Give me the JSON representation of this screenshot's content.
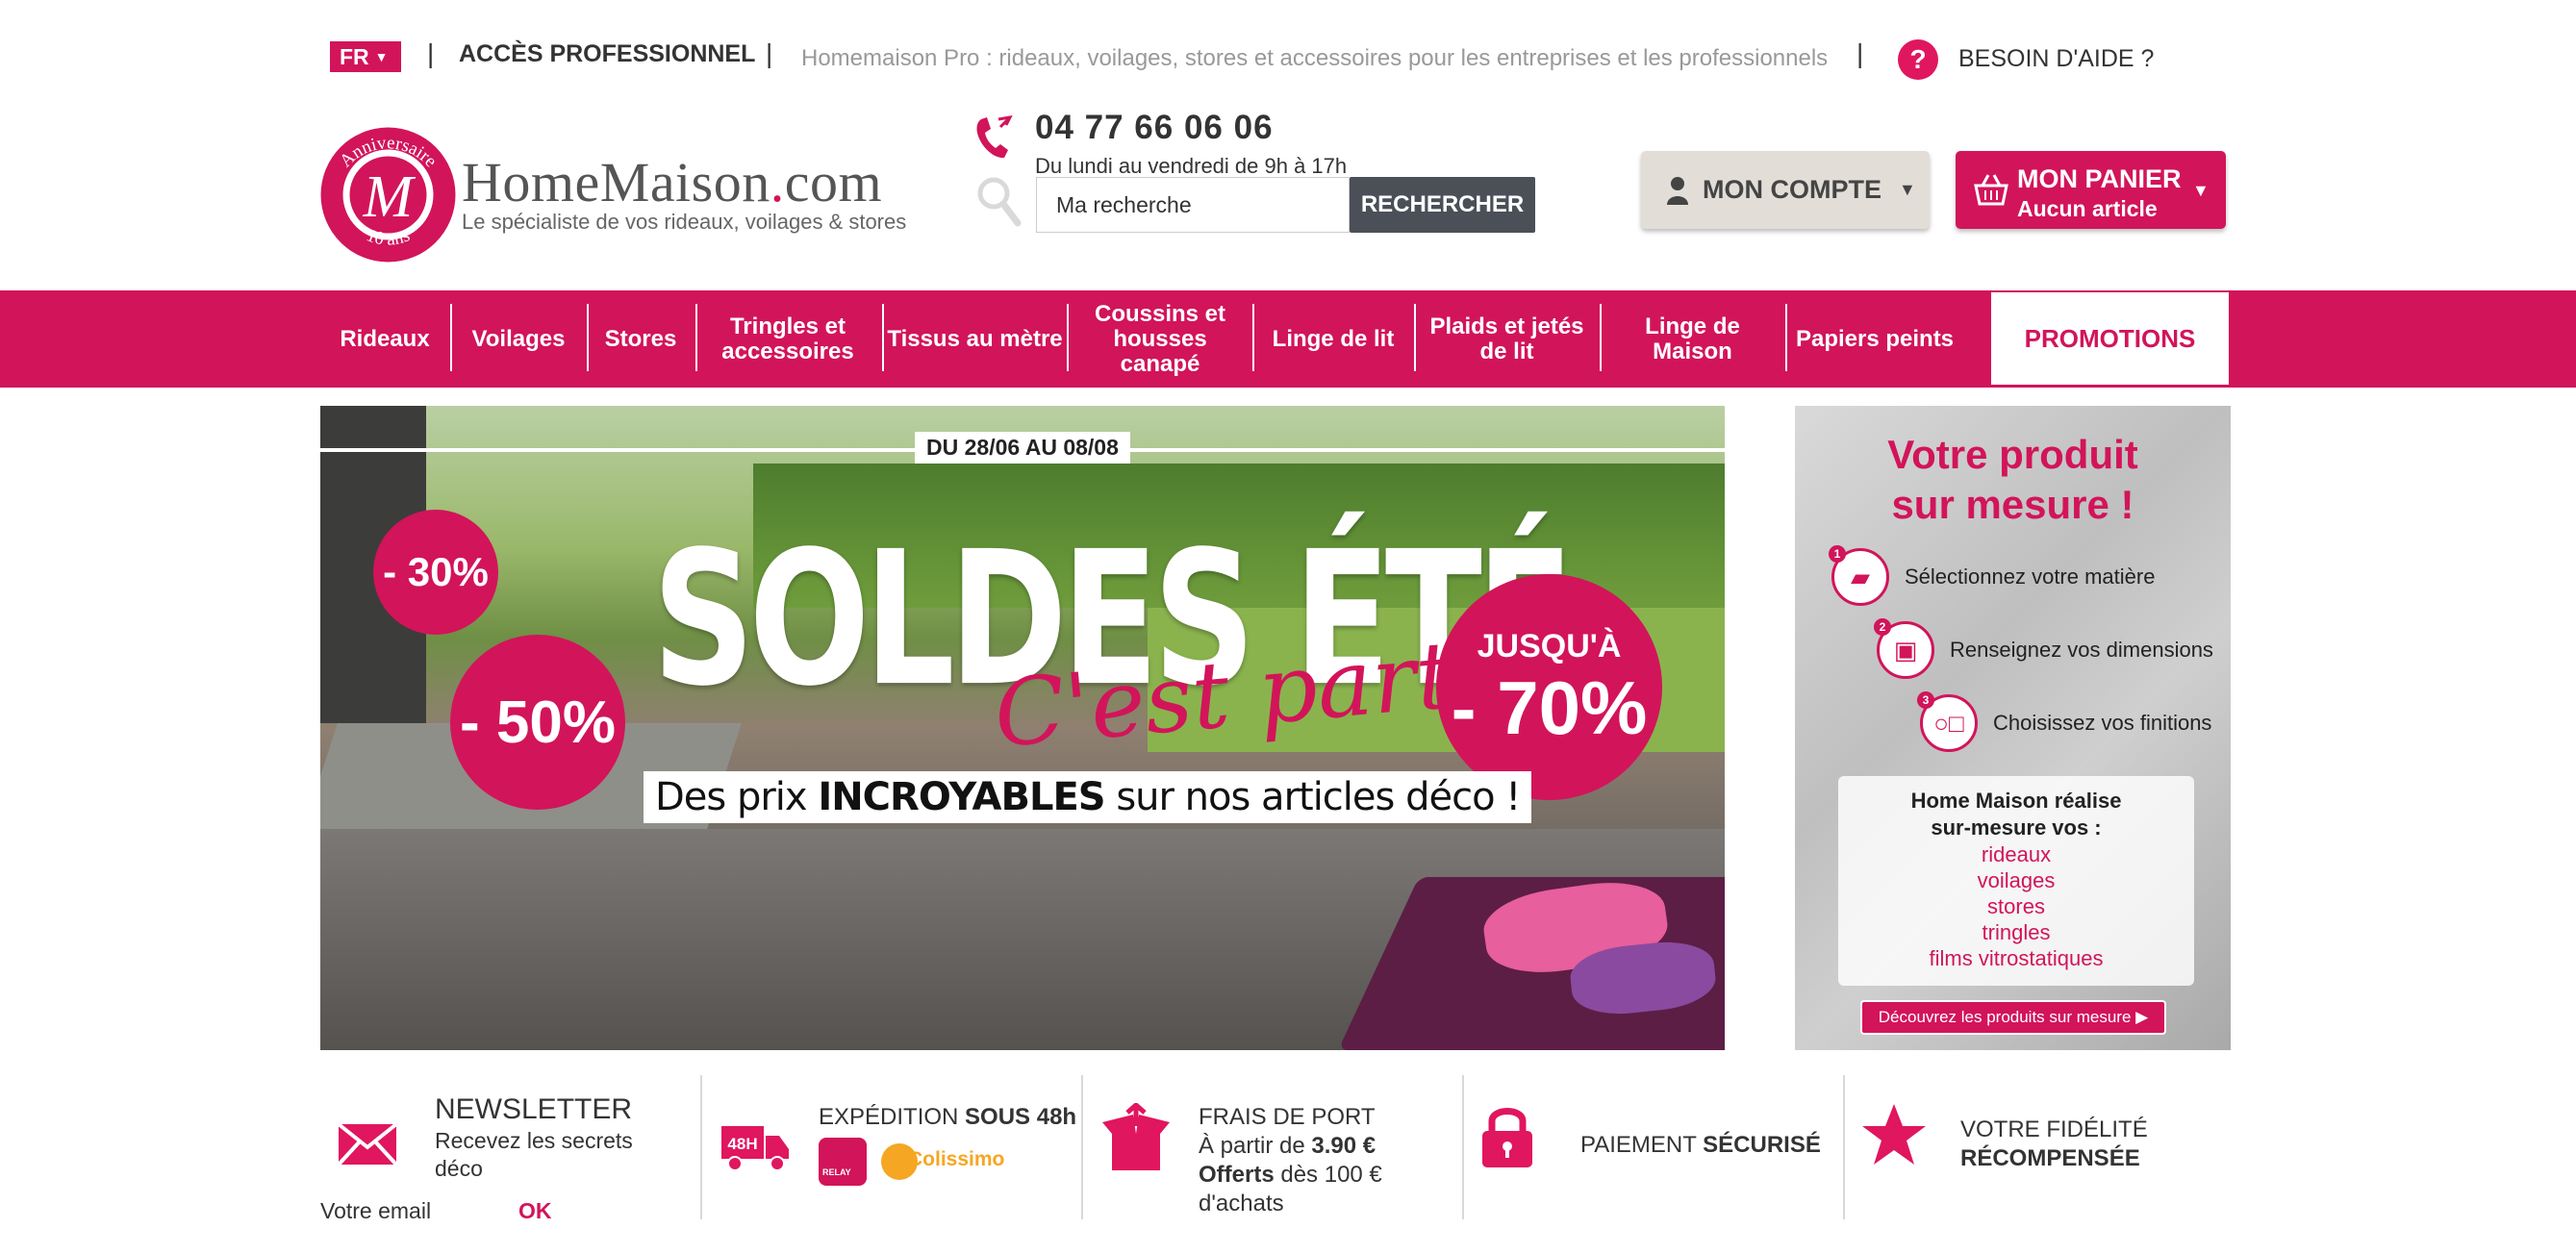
{
  "topbar": {
    "lang": "FR",
    "pro_link": "ACCÈS PROFESSIONNEL",
    "pro_tagline": "Homemaison Pro : rideaux, voilages, stores et accessoires pour les entreprises et les professionnels",
    "help": "BESOIN D'AIDE ?"
  },
  "logo": {
    "title_a": "HomeMaison",
    "title_dot": ".",
    "title_b": "com",
    "subtitle": "Le spécialiste de vos rideaux, voilages & stores",
    "badge_top": "Anniversaire",
    "badge_bottom": "10 ans",
    "badge_letter": "M"
  },
  "contact": {
    "phone": "04 77 66 06 06",
    "hours": "Du lundi au vendredi de 9h à 17h"
  },
  "search": {
    "placeholder": "Ma recherche",
    "button": "RECHERCHER"
  },
  "account": {
    "label": "MON COMPTE"
  },
  "cart": {
    "label": "MON PANIER",
    "status": "Aucun article"
  },
  "nav": {
    "items": [
      "Rideaux",
      "Voilages",
      "Stores",
      "Tringles et accessoires",
      "Tissus au mètre",
      "Coussins et housses canapé",
      "Linge de lit",
      "Plaids et jetés de lit",
      "Linge de Maison",
      "Papiers peints"
    ],
    "promo": "PROMOTIONS"
  },
  "hero": {
    "dates": "DU 28/06 AU 08/08",
    "disc30": "- 30%",
    "disc50": "- 50%",
    "upto": "JUSQU'À",
    "disc70": "- 70%",
    "title": "SOLDES ÉTÉ",
    "script": "C'est parti !",
    "banner_a": "Des prix ",
    "banner_b": "INCROYABLES",
    "banner_c": " sur nos articles déco !"
  },
  "side": {
    "title_1": "Votre produit",
    "title_2": "sur mesure !",
    "steps": [
      "Sélectionnez votre matière",
      "Renseignez vos dimensions",
      "Choisissez vos finitions"
    ],
    "box_head_1": "Home Maison réalise",
    "box_head_2": "sur-mesure vos :",
    "products": [
      "rideaux",
      "voilages",
      "stores",
      "tringles",
      "films vitrostatiques"
    ],
    "cta": "Découvrez les produits sur mesure ▶"
  },
  "features": {
    "newsletter_title": "NEWSLETTER",
    "newsletter_sub": "Recevez les secrets déco",
    "email_label": "Votre email",
    "ok": "OK",
    "shipping_a": "EXPÉDITION ",
    "shipping_b": "SOUS 48h",
    "truck_label": "48H",
    "relay_label": "RELAY",
    "colissimo_label": "Colissimo",
    "port_a": "FRAIS DE PORT",
    "port_b": "À partir de ",
    "port_c": "3.90 €",
    "port_d": "Offerts",
    "port_e": " dès 100 €",
    "port_f": "d'achats",
    "payment_a": "PAIEMENT ",
    "payment_b": "SÉCURISÉ",
    "loyalty_a": "VOTRE FIDÉLITÉ",
    "loyalty_b": "RÉCOMPENSÉE"
  },
  "colors": {
    "brand": "#d2145a",
    "dark_button": "#4a4f58",
    "account_bg": "#e3ddd8"
  }
}
